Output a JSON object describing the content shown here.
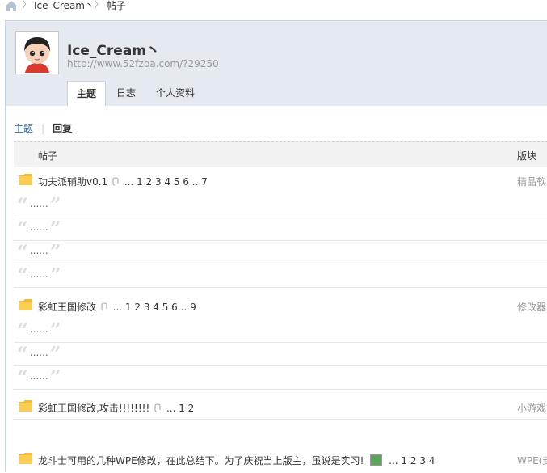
{
  "breadcrumb": {
    "user": "Ice_Cream丶",
    "current": "帖子"
  },
  "profile": {
    "name": "Ice_Cream丶",
    "url": "http://www.52fzba.com/?29250"
  },
  "tabs": [
    "主题",
    "日志",
    "个人资料"
  ],
  "subtabs": {
    "topics": "主题",
    "replies": "回复"
  },
  "table": {
    "col_post": "帖子",
    "col_forum": "版块"
  },
  "quote_text": "......",
  "threads": [
    {
      "title": "功夫派辅助v0.1",
      "pages": "... 1 2 3 4 5 6 .. 7",
      "forum": "精品软",
      "quotes": 4
    },
    {
      "title": "彩虹王国修改",
      "pages": "... 1 2 3 4 5 6 .. 9",
      "forum": "修改器",
      "quotes": 3
    },
    {
      "title": "彩虹王国修改,攻击!!!!!!!!",
      "pages": "... 1 2",
      "forum": "小游戏",
      "quotes": 0
    },
    {
      "title": "龙斗士可用的几种WPE修改，在此总结下。为了庆祝当上版主，虽说是实习!",
      "pages": "... 1 2 3 4",
      "forum": "WPE(封",
      "quotes": 0
    }
  ]
}
